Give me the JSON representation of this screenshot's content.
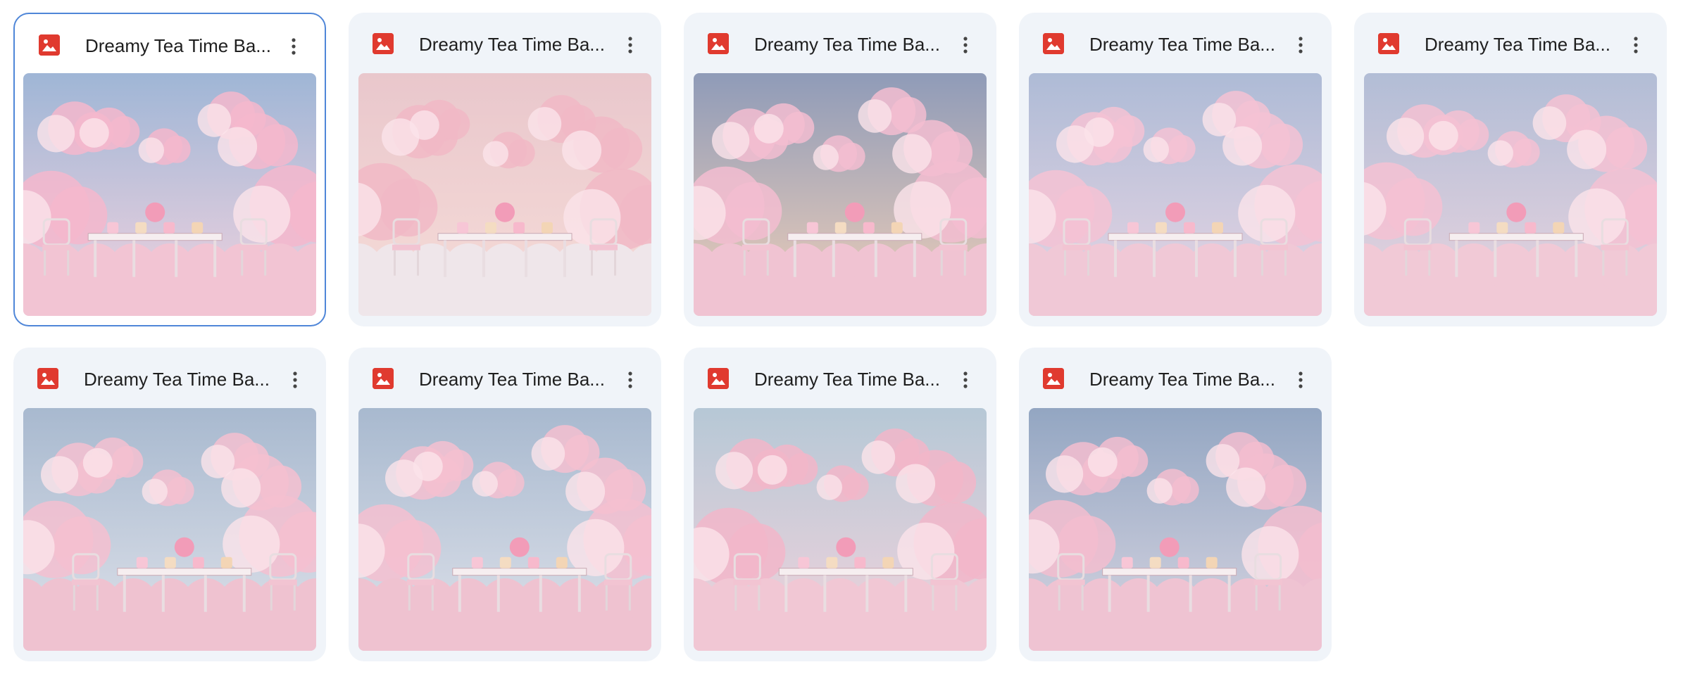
{
  "files": [
    {
      "title": "Dreamy Tea Time Ba...",
      "selected": true,
      "icon": "image-file-icon",
      "thumbnail": "pink-clouds-tea-table"
    },
    {
      "title": "Dreamy Tea Time Ba...",
      "selected": false,
      "icon": "image-file-icon",
      "thumbnail": "pink-clouds-tea-table"
    },
    {
      "title": "Dreamy Tea Time Ba...",
      "selected": false,
      "icon": "image-file-icon",
      "thumbnail": "pink-clouds-tea-table"
    },
    {
      "title": "Dreamy Tea Time Ba...",
      "selected": false,
      "icon": "image-file-icon",
      "thumbnail": "pink-clouds-tea-table"
    },
    {
      "title": "Dreamy Tea Time Ba...",
      "selected": false,
      "icon": "image-file-icon",
      "thumbnail": "pink-clouds-tea-table"
    },
    {
      "title": "Dreamy Tea Time Ba...",
      "selected": false,
      "icon": "image-file-icon",
      "thumbnail": "pink-clouds-tea-table"
    },
    {
      "title": "Dreamy Tea Time Ba...",
      "selected": false,
      "icon": "image-file-icon",
      "thumbnail": "pink-clouds-tea-table"
    },
    {
      "title": "Dreamy Tea Time Ba...",
      "selected": false,
      "icon": "image-file-icon",
      "thumbnail": "pink-clouds-tea-table"
    },
    {
      "title": "Dreamy Tea Time Ba...",
      "selected": false,
      "icon": "image-file-icon",
      "thumbnail": "pink-clouds-tea-table"
    }
  ],
  "colors": {
    "card_bg": "#f0f4f9",
    "selected_border": "#4f86d8",
    "file_icon": "#e03a2f",
    "title_text": "#1f1f1f"
  }
}
